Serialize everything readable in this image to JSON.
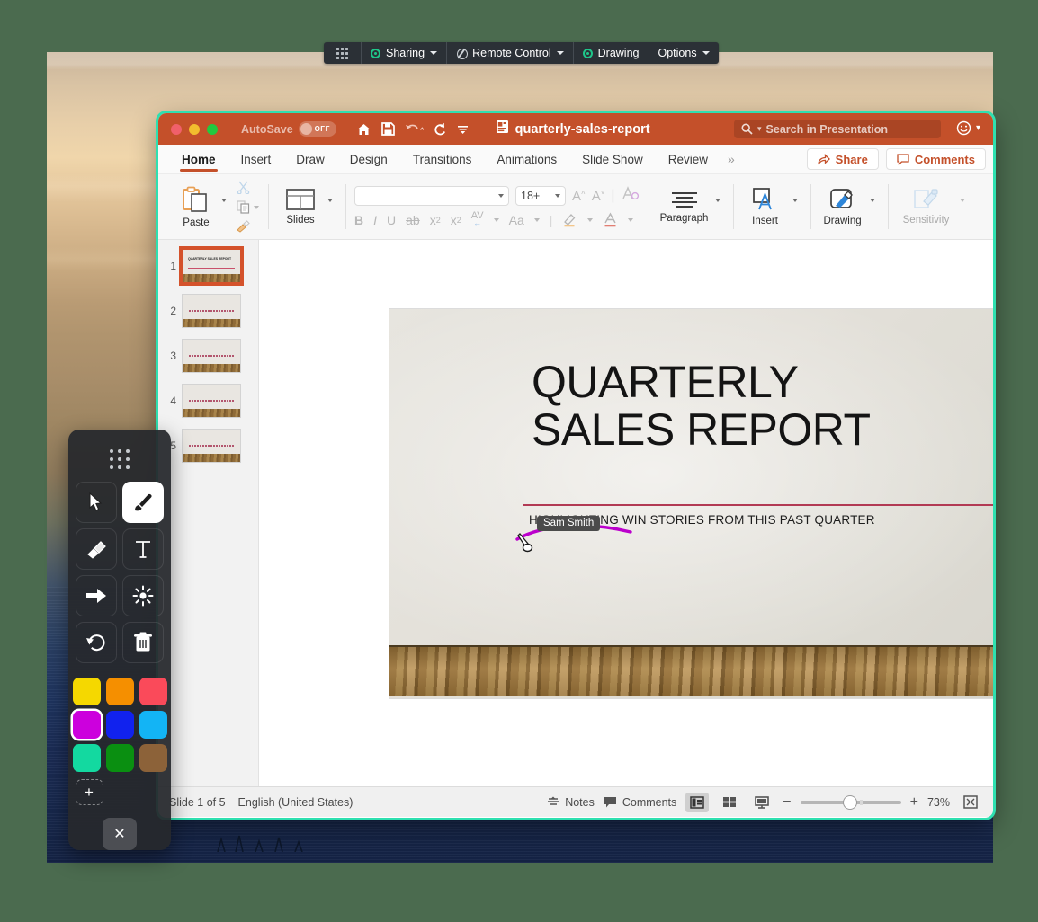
{
  "share_bar": {
    "grip": "grip-dots-icon",
    "items": [
      {
        "label": "Sharing",
        "icon": "record-circle-icon",
        "caret": true
      },
      {
        "label": "Remote Control",
        "icon": "no-control-icon",
        "caret": true
      },
      {
        "label": "Drawing",
        "icon": "record-circle-icon",
        "caret": false
      },
      {
        "label": "Options",
        "icon": "",
        "caret": true
      }
    ]
  },
  "window": {
    "titlebar": {
      "autosave_label": "AutoSave",
      "autosave_state": "OFF",
      "doc_name": "quarterly-sales-report",
      "quick_icons": [
        "home-icon",
        "save-icon",
        "undo-icon",
        "redo-icon",
        "customize-icon"
      ],
      "search_placeholder": "Search in Presentation",
      "account_icon": "smiley-account-icon",
      "accent_color": "#c4502a"
    },
    "ribbon_tabs": {
      "items": [
        "Home",
        "Insert",
        "Draw",
        "Design",
        "Transitions",
        "Animations",
        "Slide Show",
        "Review"
      ],
      "active": "Home",
      "overflow": "»",
      "share_label": "Share",
      "comments_label": "Comments"
    },
    "ribbon": {
      "paste_label": "Paste",
      "slides_label": "Slides",
      "paragraph_label": "Paragraph",
      "insert_label": "Insert",
      "drawing_label": "Drawing",
      "sensitivity_label": "Sensitivity",
      "font_name": "",
      "font_size": "18+",
      "format_icons": [
        "bold",
        "italic",
        "underline",
        "strikethrough",
        "superscript",
        "subscript",
        "character-spacing",
        "change-case",
        "text-highlight",
        "font-color"
      ],
      "grow_font": "A",
      "shrink_font": "A",
      "clear_format": "A"
    },
    "thumbnails": [
      {
        "number": "1",
        "selected": true,
        "title": "QUARTERLY SALES REPORT"
      },
      {
        "number": "2",
        "selected": false,
        "title": ""
      },
      {
        "number": "3",
        "selected": false,
        "title": ""
      },
      {
        "number": "4",
        "selected": false,
        "title": ""
      },
      {
        "number": "5",
        "selected": false,
        "title": ""
      }
    ],
    "slide": {
      "title_line1": "QUARTERLY",
      "title_line2": "SALES REPORT",
      "subtitle": "HIGHLIGHTING WIN STORIES FROM THIS PAST QUARTER",
      "rule_color": "#b23a54",
      "ink_color": "#bb00cc",
      "cursor_label": "Sam Smith"
    },
    "status_bar": {
      "slide_counter": "Slide 1 of 5",
      "language": "English (United States)",
      "notes_label": "Notes",
      "comments_label": "Comments",
      "zoom_level": "73%",
      "view_icons": [
        "normal-view-icon",
        "slide-sorter-icon",
        "presenter-view-icon"
      ],
      "zoom_out": "−",
      "zoom_in": "+",
      "fit_icon": "fit-slide-icon"
    }
  },
  "draw_toolbar": {
    "grip": "grip-dots-icon",
    "tools": [
      {
        "name": "select-arrow-tool",
        "active": false
      },
      {
        "name": "brush-tool",
        "active": true
      },
      {
        "name": "eraser-tool",
        "active": false
      },
      {
        "name": "text-tool",
        "active": false
      },
      {
        "name": "arrow-tool",
        "active": false
      },
      {
        "name": "spotlight-tool",
        "active": false
      },
      {
        "name": "undo-tool",
        "active": false
      },
      {
        "name": "delete-tool",
        "active": false
      }
    ],
    "colors": [
      {
        "hex": "#f5d800",
        "selected": false
      },
      {
        "hex": "#f58f00",
        "selected": false
      },
      {
        "hex": "#fa4a5a",
        "selected": false
      },
      {
        "hex": "#cc00dd",
        "selected": true
      },
      {
        "hex": "#1122ee",
        "selected": false
      },
      {
        "hex": "#13b4f5",
        "selected": false
      },
      {
        "hex": "#13d9a0",
        "selected": false
      },
      {
        "hex": "#0a8f11",
        "selected": false
      },
      {
        "hex": "#8c6239",
        "selected": false
      }
    ],
    "add_color_label": "+",
    "close_label": "✕"
  }
}
